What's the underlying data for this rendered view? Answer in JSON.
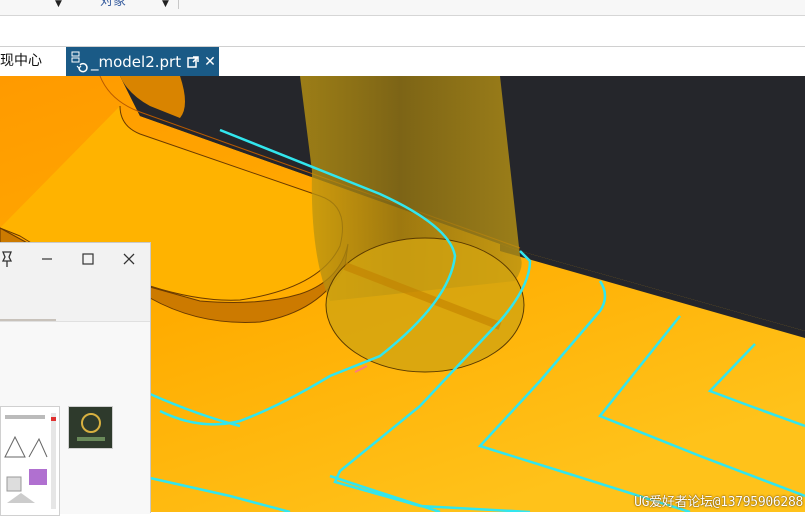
{
  "toolbar": {
    "object_label": "对象"
  },
  "tabs": [
    {
      "label": "现中心",
      "active": false
    },
    {
      "label": "_model2.prt",
      "active": true
    }
  ],
  "watermark": "UG爱好者论坛@13795906288",
  "colors": {
    "tab_active_bg": "#1a5a86",
    "model_orange": "#ffa800",
    "edge_cyan": "#32e6ee",
    "background_dark": "#25262b"
  }
}
